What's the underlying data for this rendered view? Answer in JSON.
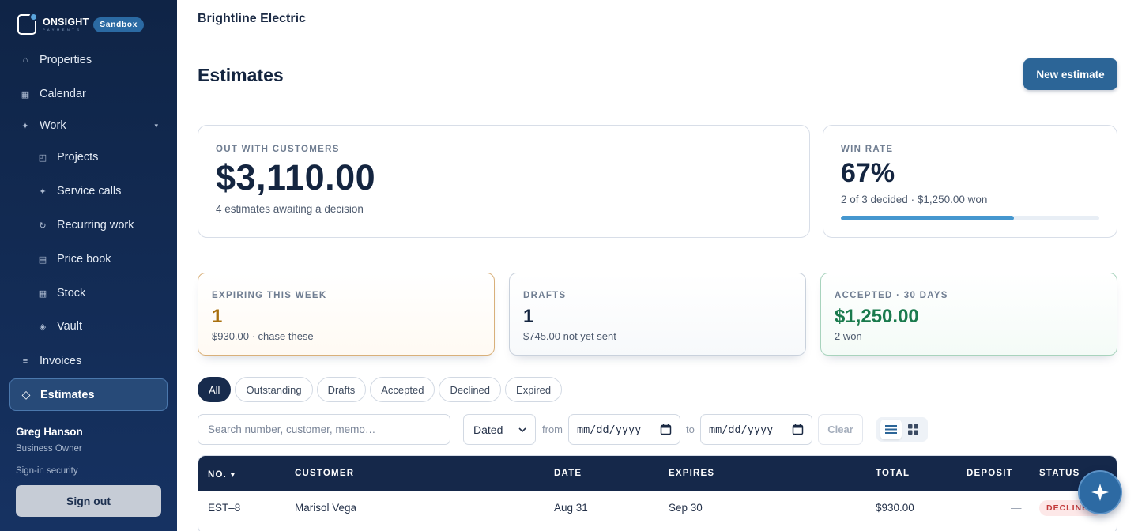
{
  "brand": {
    "name": "ONSIGHT",
    "sub": "PAYMENTS",
    "env_badge": "Sandbox"
  },
  "nav": {
    "properties": "Properties",
    "calendar": "Calendar",
    "work": "Work",
    "projects": "Projects",
    "service_calls": "Service calls",
    "recurring_work": "Recurring work",
    "price_book": "Price book",
    "stock": "Stock",
    "vault": "Vault",
    "invoices": "Invoices",
    "estimates": "Estimates"
  },
  "user": {
    "name": "Greg Hanson",
    "role": "Business Owner",
    "security_link": "Sign-in security",
    "sign_out": "Sign out"
  },
  "header": {
    "company": "Brightline Electric",
    "title": "Estimates",
    "new_button": "New estimate"
  },
  "stats": {
    "out": {
      "label": "OUT WITH CUSTOMERS",
      "value": "$3,110.00",
      "sub": "4 estimates awaiting a decision"
    },
    "win": {
      "label": "WIN RATE",
      "value": "67%",
      "sub": "2 of 3 decided · $1,250.00 won",
      "progress": 0.67,
      "progress_color": "#4597cf"
    },
    "expiring": {
      "label": "EXPIRING THIS WEEK",
      "value": "1",
      "sub": "$930.00 · chase these",
      "color": "#a9700f"
    },
    "drafts": {
      "label": "DRAFTS",
      "value": "1",
      "sub": "$745.00 not yet sent",
      "color": "#142540"
    },
    "accepted": {
      "label": "ACCEPTED · 30 DAYS",
      "value": "$1,250.00",
      "sub": "2 won",
      "color": "#1a7a4d"
    }
  },
  "filters": {
    "tabs": [
      "All",
      "Outstanding",
      "Drafts",
      "Accepted",
      "Declined",
      "Expired"
    ],
    "active_tab": "All",
    "search_placeholder": "Search number, customer, memo…",
    "date_field": "Dated",
    "from_label": "from",
    "to_label": "to",
    "date_placeholder": "mm/dd/yyyy",
    "clear": "Clear"
  },
  "table": {
    "columns": {
      "no": "NO. ▾",
      "customer": "CUSTOMER",
      "date": "DATE",
      "expires": "EXPIRES",
      "total": "TOTAL",
      "deposit": "DEPOSIT",
      "status": "STATUS"
    },
    "rows": [
      {
        "no": "EST–8",
        "customer": "Marisol Vega",
        "date": "Aug 31",
        "expires": "Sep 30",
        "total": "$930.00",
        "deposit": "—",
        "status": "DECLINED"
      }
    ]
  }
}
